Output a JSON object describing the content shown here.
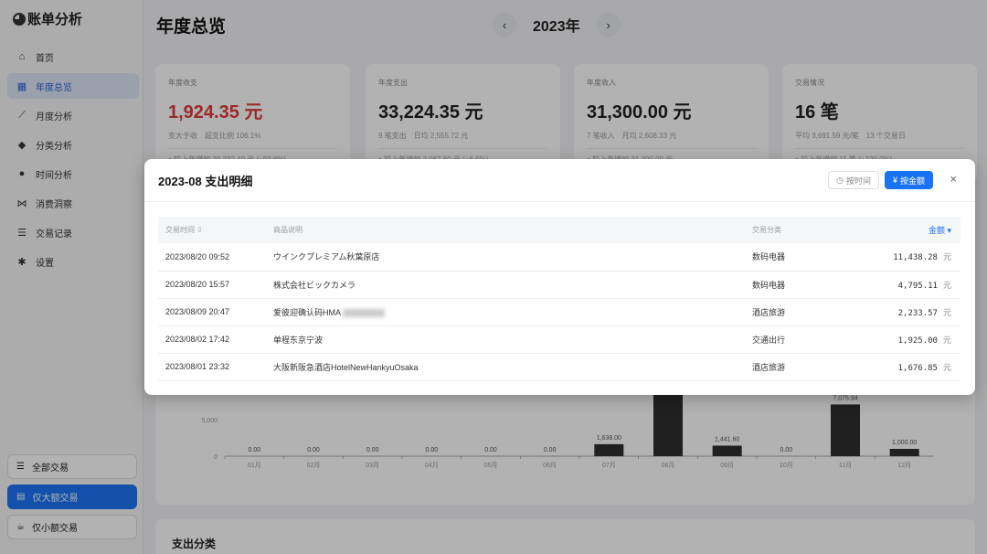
{
  "app": {
    "title": "账单分析"
  },
  "sidebar": {
    "items": [
      {
        "label": "首页",
        "icon": "home-icon"
      },
      {
        "label": "年度总览",
        "icon": "calendar-icon"
      },
      {
        "label": "月度分析",
        "icon": "line-chart-icon"
      },
      {
        "label": "分类分析",
        "icon": "tag-icon"
      },
      {
        "label": "时间分析",
        "icon": "clock-icon"
      },
      {
        "label": "消费洞察",
        "icon": "network-icon"
      },
      {
        "label": "交易记录",
        "icon": "list-icon"
      },
      {
        "label": "设置",
        "icon": "gear-icon"
      }
    ],
    "filters": [
      "全部交易",
      "仅大额交易",
      "仅小额交易"
    ]
  },
  "header": {
    "title": "年度总览",
    "year": "2023年",
    "prev": "‹",
    "next": "›"
  },
  "cards": [
    {
      "label": "年度收支",
      "value": "1,924.35 元",
      "sub": "支大于收　超支比例 106.1%",
      "delta": "较上年增加 29,232.40 元 (+93.8%)"
    },
    {
      "label": "年度支出",
      "value": "33,224.35 元",
      "sub": "9 笔支出　日均 2,555.72 元",
      "delta": "较上年增加 2,067.60 元 (+6.6%)"
    },
    {
      "label": "年度收入",
      "value": "31,300.00 元",
      "sub": "7 笔收入　月均 2,608.33 元",
      "delta": "较上年增加 31,300.00 元"
    },
    {
      "label": "交易情况",
      "value": "16 笔",
      "sub": "平均 3,691.59 元/笔　13 个交易日",
      "delta": "较上年增加 11 笔 (+220.0%)"
    }
  ],
  "chart_data": {
    "type": "bar",
    "categories": [
      "01月",
      "02月",
      "03月",
      "04月",
      "05月",
      "06月",
      "07月",
      "08月",
      "09月",
      "10月",
      "11月",
      "12月"
    ],
    "values": [
      0,
      0,
      0,
      0,
      0,
      0,
      1638,
      19000,
      1441.6,
      0,
      7075.94,
      1000
    ],
    "value_labels": [
      "0.00",
      "0.00",
      "0.00",
      "0.00",
      "0.00",
      "0.00",
      "1,638.00",
      "",
      "1,441.60",
      "0.00",
      "7,075.94",
      "1,000.00"
    ],
    "y_ticks": [
      "0",
      "5,000"
    ],
    "ylim": [
      0,
      10000
    ]
  },
  "category_section": {
    "title": "支出分类"
  },
  "modal": {
    "title": "2023-08 支出明细",
    "sort_by_time": "按时间",
    "sort_by_amount": "按金额",
    "close": "×",
    "columns": {
      "time": "交易时间",
      "desc": "商品说明",
      "category": "交易分类",
      "amount": "金额"
    },
    "unit": "元",
    "rows": [
      {
        "time": "2023/08/20 09:52",
        "desc": "ウインクプレミアム秋葉原店",
        "category": "数码电器",
        "amount": "11,438.28"
      },
      {
        "time": "2023/08/20 15:57",
        "desc": "株式会社ビックカメラ",
        "category": "数码电器",
        "amount": "4,795.11"
      },
      {
        "time": "2023/08/09 20:47",
        "desc": "爱彼迎确认码HMA",
        "category": "酒店旅游",
        "amount": "2,233.57"
      },
      {
        "time": "2023/08/02 17:42",
        "desc": "单程东京宁波",
        "category": "交通出行",
        "amount": "1,925.00"
      },
      {
        "time": "2023/08/01 23:32",
        "desc": "大阪新阪急酒店HotelNewHankyuOsaka",
        "category": "酒店旅游",
        "amount": "1,676.85"
      }
    ]
  }
}
